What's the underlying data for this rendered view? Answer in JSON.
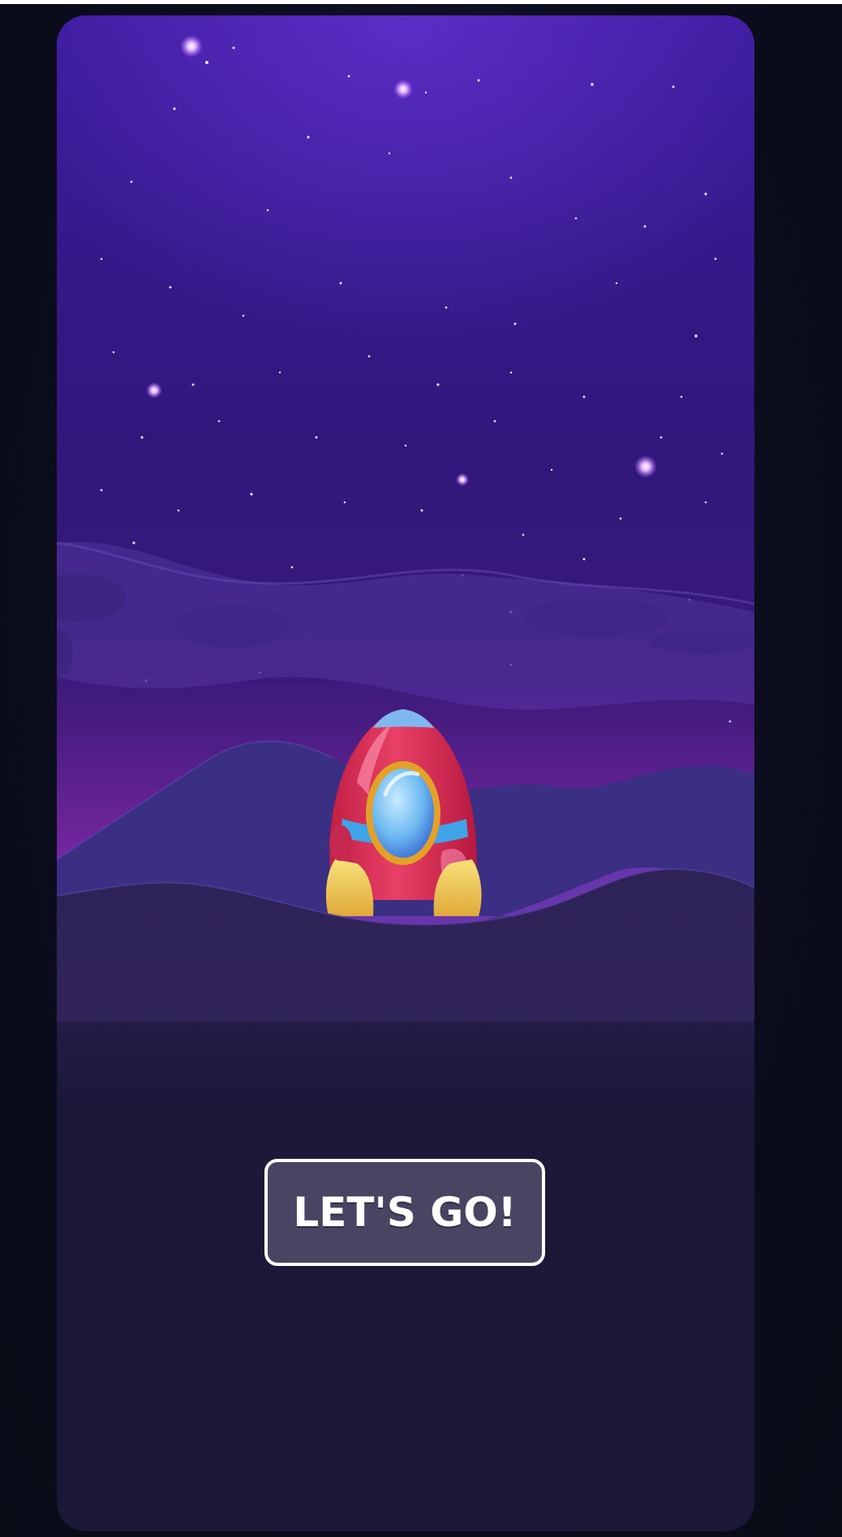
{
  "screen": {
    "name": "launch-screen"
  },
  "cta": {
    "label": "LET'S GO!"
  },
  "colors": {
    "sky_top": "#3a1a9a",
    "sky_bottom": "#2a1670",
    "ground": "#2f2356",
    "panel_bottom": "#1c1838",
    "button_fill": "#4a4463",
    "button_border": "#ffffff",
    "rocket_body": "#e0335b",
    "rocket_window": "#7fc8f5",
    "rocket_fins": "#f3d66a"
  },
  "icons": {
    "rocket": "rocket-icon"
  }
}
